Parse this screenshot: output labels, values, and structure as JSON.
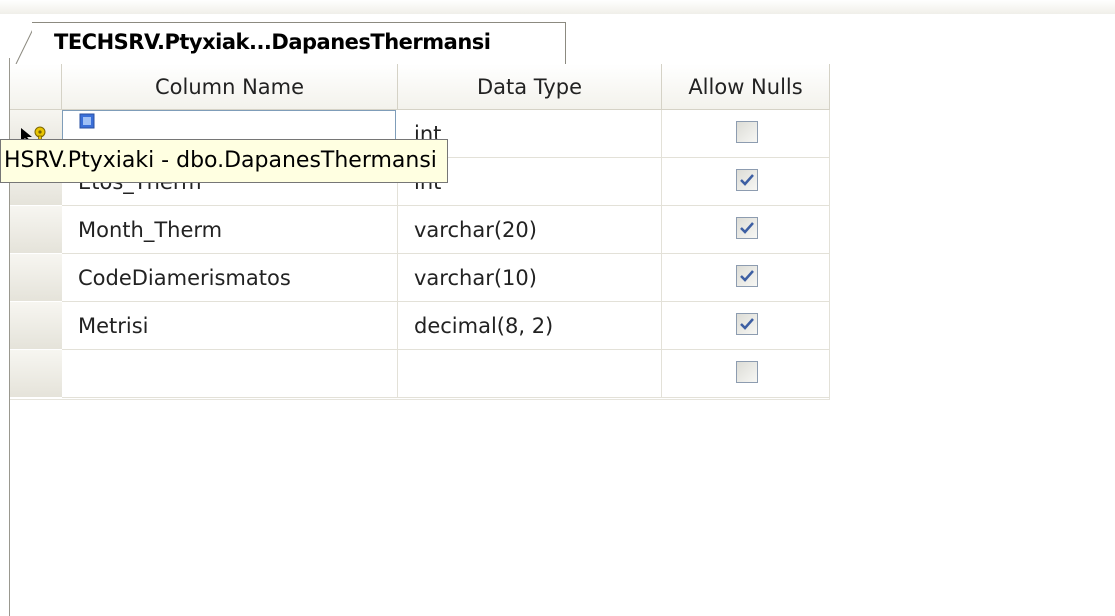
{
  "tab": {
    "title": "TECHSRV.Ptyxiak...DapanesThermansi"
  },
  "columns": {
    "name": "Column Name",
    "type": "Data Type",
    "nulls": "Allow Nulls"
  },
  "rows": [
    {
      "name": "",
      "type": "int",
      "allow_nulls": false
    },
    {
      "name": "Etos_Therm",
      "type": "int",
      "allow_nulls": true
    },
    {
      "name": "Month_Therm",
      "type": "varchar(20)",
      "allow_nulls": true
    },
    {
      "name": "CodeDiamerismatos",
      "type": "varchar(10)",
      "allow_nulls": true
    },
    {
      "name": "Metrisi",
      "type": "decimal(8, 2)",
      "allow_nulls": true
    },
    {
      "name": "",
      "type": "",
      "allow_nulls": false
    }
  ],
  "tooltip": {
    "text": "HSRV.Ptyxiaki - dbo.DapanesThermansi"
  },
  "icons": {
    "primary_key": "primary-key-icon",
    "row_selector": "current-row-pointer-icon"
  }
}
